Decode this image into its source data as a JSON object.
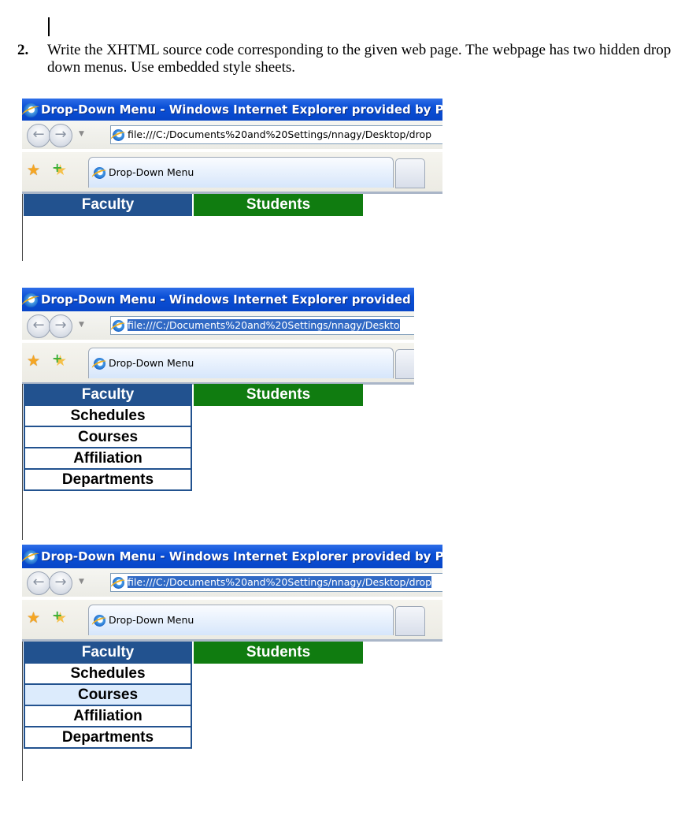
{
  "question": {
    "number": "2.",
    "text": "Write the XHTML source code corresponding to the given web page. The webpage has two hidden drop down menus. Use embedded style sheets."
  },
  "colors": {
    "faculty_bg": "#22528f",
    "students_bg": "#107c10",
    "hover_bg": "#dcebfc"
  },
  "screenshots": [
    {
      "window_title": "Drop-Down Menu - Windows Internet Explorer provided by PMU",
      "address": "file:///C:/Documents%20and%20Settings/nnagy/Desktop/drop",
      "address_selected": false,
      "tab_label": "Drop-Down Menu",
      "menu": {
        "faculty": "Faculty",
        "students": "Students"
      },
      "dropdown_visible": false
    },
    {
      "window_title": "Drop-Down Menu - Windows Internet Explorer provided by",
      "address": "file:///C:/Documents%20and%20Settings/nnagy/Deskto",
      "address_selected": true,
      "tab_label": "Drop-Down Menu",
      "menu": {
        "faculty": "Faculty",
        "students": "Students"
      },
      "dropdown_visible": true,
      "dropdown_items": [
        "Schedules",
        "Courses",
        "Affiliation",
        "Departments"
      ],
      "hovered_item": null
    },
    {
      "window_title": "Drop-Down Menu - Windows Internet Explorer provided by PMU",
      "address": "file:///C:/Documents%20and%20Settings/nnagy/Desktop/drop",
      "address_selected": true,
      "tab_label": "Drop-Down Menu",
      "menu": {
        "faculty": "Faculty",
        "students": "Students"
      },
      "dropdown_visible": true,
      "dropdown_items": [
        "Schedules",
        "Courses",
        "Affiliation",
        "Departments"
      ],
      "hovered_item": "Courses"
    }
  ]
}
